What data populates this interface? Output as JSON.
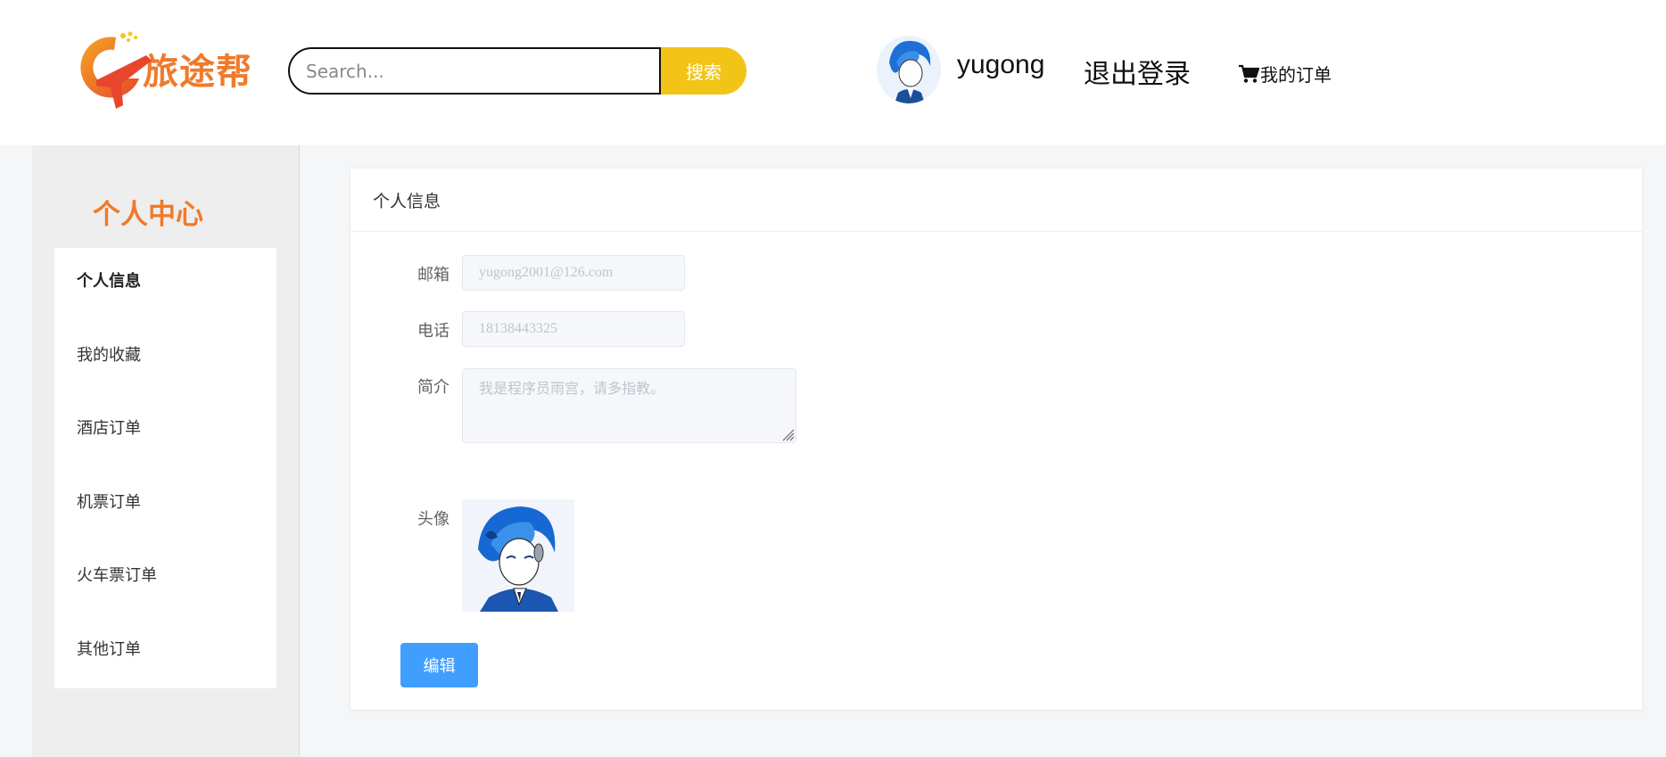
{
  "header": {
    "logo_text": "旅途帮",
    "search": {
      "placeholder": "Search...",
      "value": "",
      "button_label": "搜索"
    },
    "username": "yugong",
    "logout_label": "退出登录",
    "orders_label": "我的订单",
    "brand_color": "#f07a2a",
    "search_button_color": "#f2c417"
  },
  "sidebar": {
    "title": "个人中心",
    "items": [
      {
        "label": "个人信息",
        "active": true
      },
      {
        "label": "我的收藏",
        "active": false
      },
      {
        "label": "酒店订单",
        "active": false
      },
      {
        "label": "机票订单",
        "active": false
      },
      {
        "label": "火车票订单",
        "active": false
      },
      {
        "label": "其他订单",
        "active": false
      }
    ]
  },
  "main": {
    "card_title": "个人信息",
    "fields": {
      "email": {
        "label": "邮箱",
        "placeholder": "yugong2001@126.com"
      },
      "phone": {
        "label": "电话",
        "placeholder": "18138443325"
      },
      "bio": {
        "label": "简介",
        "placeholder": "我是程序员雨宫，请多指教。"
      },
      "avatar": {
        "label": "头像"
      }
    },
    "edit_button_label": "编辑",
    "primary_color": "#409eff"
  }
}
